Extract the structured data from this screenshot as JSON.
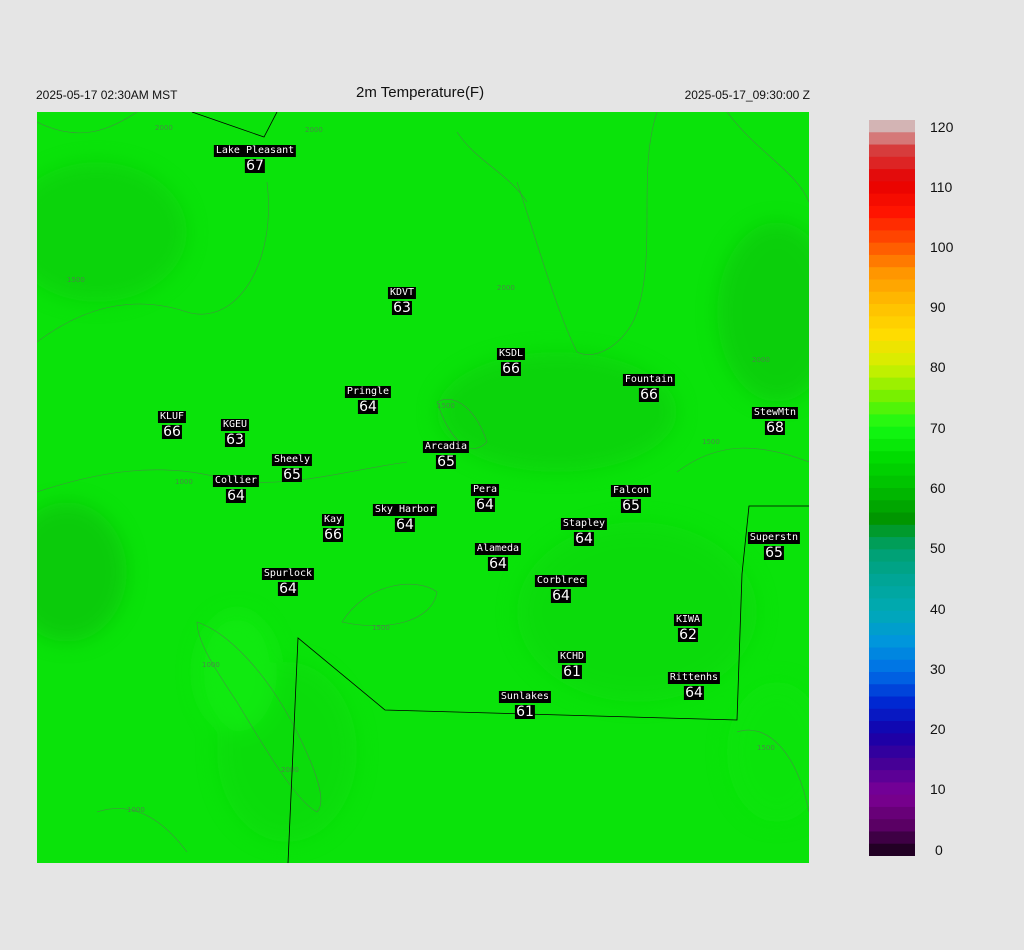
{
  "header": {
    "left": "2025-05-17 02:30AM MST",
    "title": "2m Temperature(F)",
    "right": "2025-05-17_09:30:00 Z"
  },
  "colorbar": {
    "range": [
      0,
      120
    ],
    "ticks": [
      "120",
      "110",
      "100",
      "90",
      "80",
      "70",
      "60",
      "50",
      "40",
      "30",
      "20",
      "10",
      "0"
    ]
  },
  "contour_labels": [
    "2000",
    "1500",
    "1000",
    "1500",
    "2000",
    "1500",
    "2000",
    "1500",
    "1000",
    "2000",
    "1000",
    "2000",
    "1500"
  ],
  "stations": [
    {
      "name": "Lake Pleasant",
      "value": "67"
    },
    {
      "name": "KDVT",
      "value": "63"
    },
    {
      "name": "KSDL",
      "value": "66"
    },
    {
      "name": "Fountain",
      "value": "66"
    },
    {
      "name": "Pringle",
      "value": "64"
    },
    {
      "name": "KLUF",
      "value": "66"
    },
    {
      "name": "KGEU",
      "value": "63"
    },
    {
      "name": "StewMtn",
      "value": "68"
    },
    {
      "name": "Arcadia",
      "value": "65"
    },
    {
      "name": "Sheely",
      "value": "65"
    },
    {
      "name": "Collier",
      "value": "64"
    },
    {
      "name": "Pera",
      "value": "64"
    },
    {
      "name": "Falcon",
      "value": "65"
    },
    {
      "name": "Kay",
      "value": "66"
    },
    {
      "name": "Sky Harbor",
      "value": "64"
    },
    {
      "name": "Stapley",
      "value": "64"
    },
    {
      "name": "Superstn",
      "value": "65"
    },
    {
      "name": "Alameda",
      "value": "64"
    },
    {
      "name": "Spurlock",
      "value": "64"
    },
    {
      "name": "Corblrec",
      "value": "64"
    },
    {
      "name": "KIWA",
      "value": "62"
    },
    {
      "name": "KCHD",
      "value": "61"
    },
    {
      "name": "Rittenhs",
      "value": "64"
    },
    {
      "name": "Sunlakes",
      "value": "61"
    }
  ]
}
